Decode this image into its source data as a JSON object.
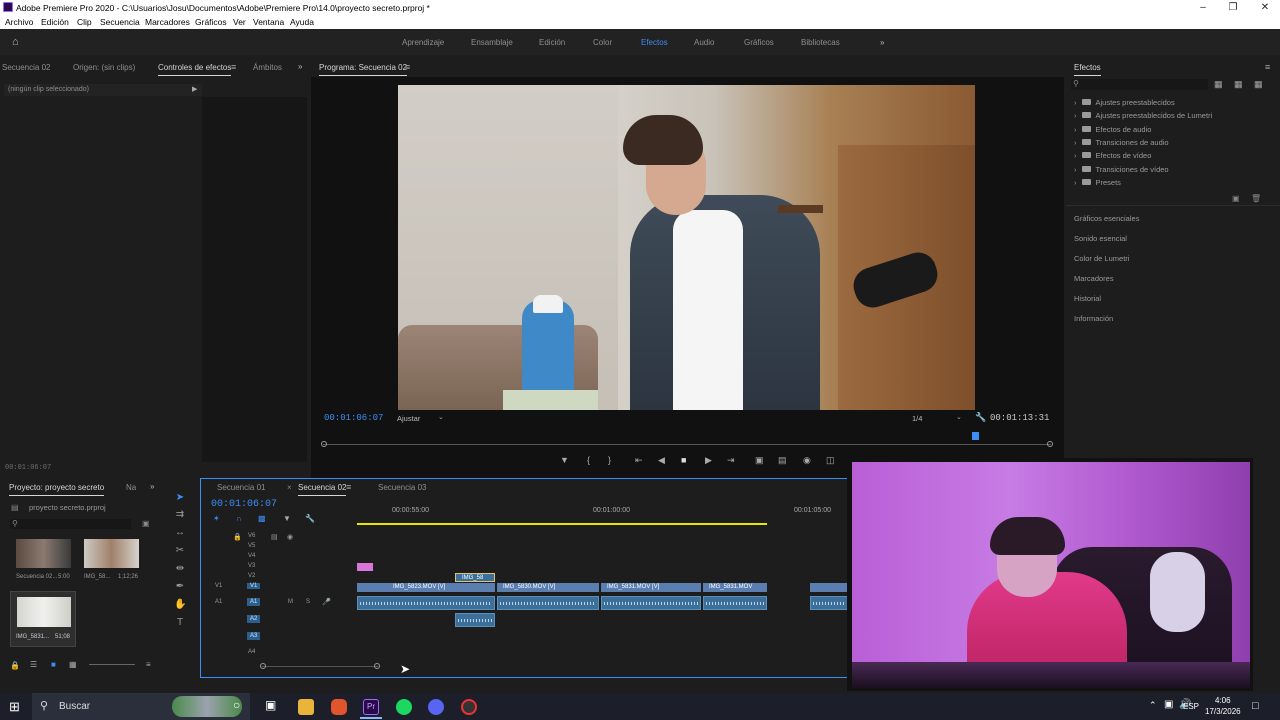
{
  "window": {
    "title": "Adobe Premiere Pro 2020 - C:\\Usuarios\\Josu\\Documentos\\Adobe\\Premiere Pro\\14.0\\proyecto secreto.prproj *"
  },
  "menu": [
    "Archivo",
    "Edición",
    "Clip",
    "Secuencia",
    "Marcadores",
    "Gráficos",
    "Ver",
    "Ventana",
    "Ayuda"
  ],
  "workspaces": [
    "Aprendizaje",
    "Ensamblaje",
    "Edición",
    "Color",
    "Efectos",
    "Audio",
    "Gráficos",
    "Bibliotecas"
  ],
  "active_workspace": "Efectos",
  "source_panel": {
    "tabs": [
      "Secuencia 02",
      "Origen: (sin clips)",
      "Controles de efectos",
      "Ámbitos"
    ],
    "no_clip": "(ningún clip seleccionado)",
    "timecode": "00:01:06:07"
  },
  "program": {
    "title": "Programa: Secuencia 02",
    "timecode": "00:01:06:07",
    "fit": "Ajustar",
    "resolution": "1/4",
    "duration": "00:01:13:31"
  },
  "effects_panel": {
    "title": "Efectos",
    "items": [
      "Ajustes preestablecidos",
      "Ajustes preestablecidos de Lumetri",
      "Efectos de audio",
      "Transiciones de audio",
      "Efectos de vídeo",
      "Transiciones de vídeo",
      "Presets"
    ],
    "sections": [
      "Gráficos esenciales",
      "Sonido esencial",
      "Color de Lumetri",
      "Marcadores",
      "Historial",
      "Información"
    ]
  },
  "project": {
    "tab": "Proyecto: proyecto secreto",
    "tab2": "Na",
    "file": "proyecto secreto.prproj",
    "thumbs": [
      {
        "name": "Secuencia 02...",
        "dur": "5:00"
      },
      {
        "name": "IMG_58...",
        "dur": "1;12;26"
      },
      {
        "name": "IMG_5831...",
        "dur": "51;08"
      }
    ]
  },
  "timeline": {
    "tabs": [
      "Secuencia 01",
      "Secuencia 02",
      "Secuencia 03"
    ],
    "timecode": "00:01:06:07",
    "ruler": [
      "00:00:55:00",
      "00:01:00:00",
      "00:01:05:00"
    ],
    "video_tracks": [
      "V6",
      "V5",
      "V4",
      "V3",
      "V2",
      "V1"
    ],
    "audio_tracks": [
      "A1",
      "A2",
      "A3",
      "A4"
    ],
    "clips": [
      "IMG_5823.MOV [V]",
      "IMG_58",
      "IMG_5830.MOV [V]",
      "IMG_5831.MOV [V]",
      "IMG_5831.MOV"
    ]
  },
  "taskbar": {
    "search": "Buscar",
    "lang": "ESP",
    "time": "4:06",
    "date": "17/3/2026"
  }
}
